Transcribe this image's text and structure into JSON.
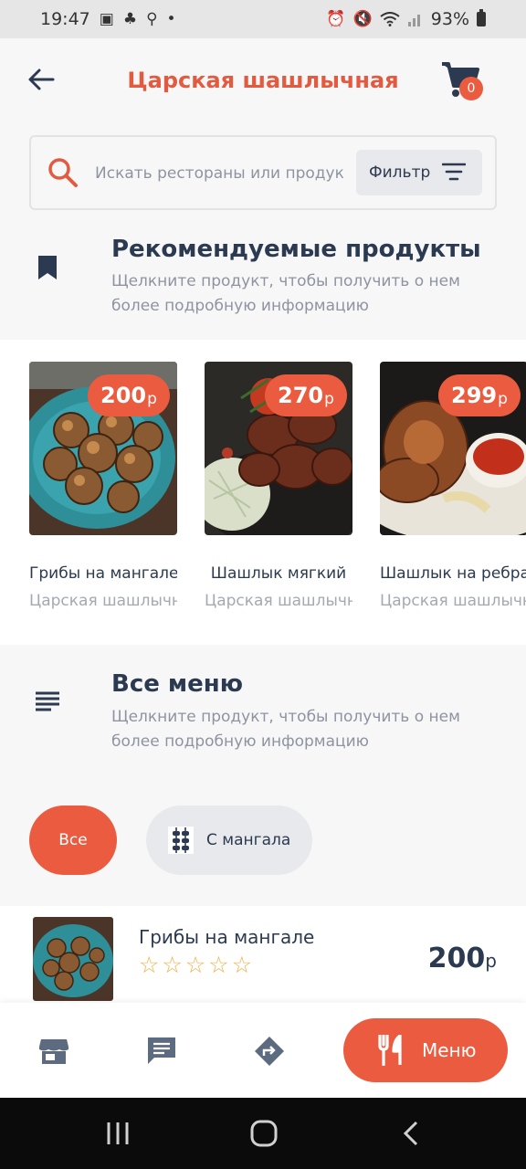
{
  "status_bar": {
    "time": "19:47",
    "battery": "93%"
  },
  "header": {
    "title": "Царская шашлычная",
    "cart_count": "0"
  },
  "search": {
    "placeholder": "Искать рестораны или продукты",
    "filter_label": "Фильтр"
  },
  "recommended": {
    "title": "Рекомендуемые продукты",
    "subtitle": "Щелкните продукт, чтобы получить о нем более подробную информацию",
    "items": [
      {
        "name": "Грибы на мангале",
        "restaurant": "Царская шашлычная",
        "price": "200",
        "currency": "р"
      },
      {
        "name": "Шашлык мягкий",
        "restaurant": "Царская шашлычная",
        "price": "270",
        "currency": "р"
      },
      {
        "name": "Шашлык на ребрах",
        "restaurant": "Царская шашлычная",
        "price": "299",
        "currency": "р"
      }
    ]
  },
  "all_menu": {
    "title": "Все меню",
    "subtitle": "Щелкните продукт, чтобы получить о нем более подробную информацию",
    "chips": [
      {
        "label": "Все"
      },
      {
        "label": "С мангала"
      }
    ]
  },
  "menu_list": [
    {
      "name": "Грибы на мангале",
      "stars": "☆☆☆☆☆",
      "price": "200",
      "currency": "р"
    }
  ],
  "bottom_nav": {
    "menu_label": "Меню"
  },
  "colors": {
    "accent": "#ea5b3f",
    "title": "#e35a40",
    "text_dark": "#2b3a50",
    "muted": "#8d94a0",
    "star": "#f0b14a"
  }
}
